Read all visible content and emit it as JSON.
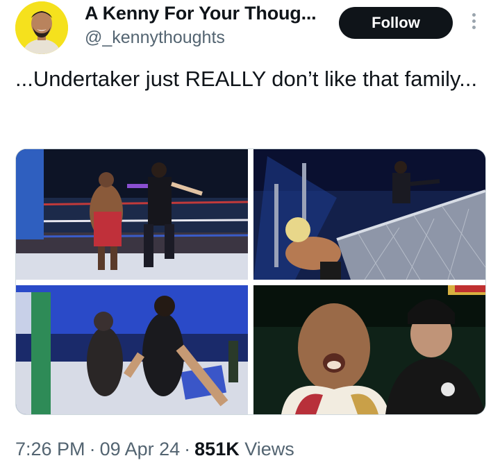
{
  "author": {
    "display_name": "A Kenny For Your Thoug...",
    "handle": "@_kennythoughts",
    "avatar_icon": "avatar-photo",
    "avatar_bg": "#f5e11d"
  },
  "actions": {
    "follow_label": "Follow",
    "more_icon": "more-vertical-icon"
  },
  "tweet": {
    "text": "...Undertaker just REALLY don’t like that family..."
  },
  "meta": {
    "time": "7:26 PM",
    "separator": "·",
    "date": "09 Apr 24",
    "views_count": "851K",
    "views_label": "Views"
  },
  "colors": {
    "text": "#0f1419",
    "secondary": "#536471",
    "follow_bg": "#0f1419"
  }
}
